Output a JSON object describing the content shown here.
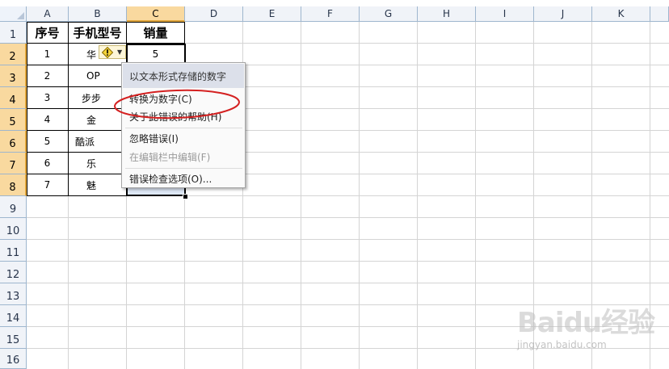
{
  "columns": [
    "A",
    "B",
    "C",
    "D",
    "E",
    "F",
    "G",
    "H",
    "I",
    "J",
    "K"
  ],
  "selected_column": "C",
  "rows": [
    "1",
    "2",
    "3",
    "4",
    "5",
    "6",
    "7",
    "8",
    "9",
    "10",
    "11",
    "12",
    "13",
    "14",
    "15",
    "16"
  ],
  "selected_rows": [
    "2",
    "3",
    "4",
    "5",
    "6",
    "7",
    "8"
  ],
  "table": {
    "headers": [
      "序号",
      "手机型号",
      "销量"
    ],
    "row_numbers": [
      "1",
      "2",
      "3",
      "4",
      "5",
      "6",
      "7"
    ],
    "models_visible": [
      "华",
      "OP",
      "步步",
      "金",
      "酷派",
      "乐",
      "魅"
    ],
    "sales_visible": [
      "5"
    ]
  },
  "error_menu": {
    "header": "以文本形式存储的数字",
    "items": [
      {
        "label": "转换为数字(C)",
        "enabled": true
      },
      {
        "label": "关于此错误的帮助(H)",
        "enabled": true
      },
      {
        "label": "忽略错误(I)",
        "enabled": true
      },
      {
        "label": "在编辑栏中编辑(F)",
        "enabled": false
      },
      {
        "label": "错误检查选项(O)...",
        "enabled": true
      }
    ]
  },
  "icons": {
    "error_button": "warning-diamond-icon",
    "dropdown": "chevron-down-icon",
    "annotation": "red-ellipse-annotation"
  },
  "watermark": {
    "logo": "Baidu经验",
    "url": "jingyan.baidu.com"
  },
  "colors": {
    "header_bg": "#f0f3f8",
    "header_selected": "#f9d99f",
    "selection_fill": "#dde7f5",
    "annotation": "#d42020"
  }
}
